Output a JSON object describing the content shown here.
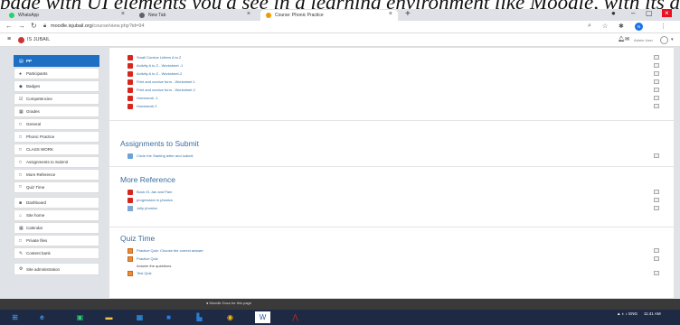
{
  "caption": "page with UI elements you'd see in a learning environment like Moodle, with its activities and resources clearly",
  "browser": {
    "tabs": [
      {
        "label": "WhatsApp",
        "color": "#25d366"
      },
      {
        "label": "New Tab",
        "color": "#5f6368"
      },
      {
        "label": "Course: Phonic Practice",
        "color": "#f29900"
      }
    ],
    "new_tab": "+",
    "url_domain": "moodle.isjubail.org",
    "url_path": "/course/view.php?id=94",
    "profile_initial": "N"
  },
  "navbar": {
    "site_name": "IS JUBAIL",
    "user_name": "Admin User"
  },
  "drawer": {
    "items": [
      {
        "label": "PP",
        "icon": "▤",
        "active": true
      },
      {
        "label": "Participants",
        "icon": "●"
      },
      {
        "label": "Badges",
        "icon": "◆"
      },
      {
        "label": "Competencies",
        "icon": "☑"
      },
      {
        "label": "Grades",
        "icon": "▦"
      },
      {
        "label": "General",
        "icon": "□"
      },
      {
        "label": "Phonic Practice",
        "icon": "□"
      },
      {
        "label": "CLASS WORK",
        "icon": "□"
      },
      {
        "label": "Assignments to Submit",
        "icon": "□"
      },
      {
        "label": "More Reference",
        "icon": "□"
      },
      {
        "label": "Quiz Time",
        "icon": "□"
      },
      {
        "label": "Dashboard",
        "icon": "■",
        "gap": true
      },
      {
        "label": "Site home",
        "icon": "⌂"
      },
      {
        "label": "Calendar",
        "icon": "▦"
      },
      {
        "label": "Private files",
        "icon": "□"
      },
      {
        "label": "Content bank",
        "icon": "✎"
      },
      {
        "label": "Site administration",
        "icon": "⚙",
        "gap": true
      }
    ]
  },
  "sections": {
    "top": {
      "items": [
        {
          "label": "Small Cursive Letters A to Z",
          "icon": "pdf"
        },
        {
          "label": "Activity A to Z - Worksheet -1",
          "icon": "pdf"
        },
        {
          "label": "Activity A to Z - Worksheet-2",
          "icon": "pdf"
        },
        {
          "label": "Print and cursive form - Worksheet 1",
          "icon": "pdf"
        },
        {
          "label": "Print and cursive form - Worksheet 2",
          "icon": "pdf"
        },
        {
          "label": "Homework -1",
          "icon": "pdf"
        },
        {
          "label": "Homework 2",
          "icon": "pdf"
        }
      ]
    },
    "assignments": {
      "title": "Assignments to Submit",
      "items": [
        {
          "label": "Circle the Starting letter and submit",
          "icon": "assign"
        }
      ]
    },
    "reference": {
      "title": "More Reference",
      "items": [
        {
          "label": "Book 01 Jan and Pam",
          "icon": "pdf"
        },
        {
          "label": "progression in phonics",
          "icon": "pdf"
        },
        {
          "label": "Jolly phonics",
          "icon": "link"
        }
      ]
    },
    "quiz": {
      "title": "Quiz Time",
      "items": [
        {
          "label": "Practice Quiz: Choose the correct answer",
          "icon": "quiz"
        },
        {
          "label": "Practice Quiz",
          "icon": "quiz"
        },
        {
          "label": "Answer the questions.",
          "icon": "none"
        },
        {
          "label": "Test Quiz",
          "icon": "quiz"
        }
      ]
    }
  },
  "footer": {
    "docs_link": "Moodle Docs for this page"
  },
  "taskbar": {
    "time": "11:41 AM",
    "lang": "ENG"
  }
}
